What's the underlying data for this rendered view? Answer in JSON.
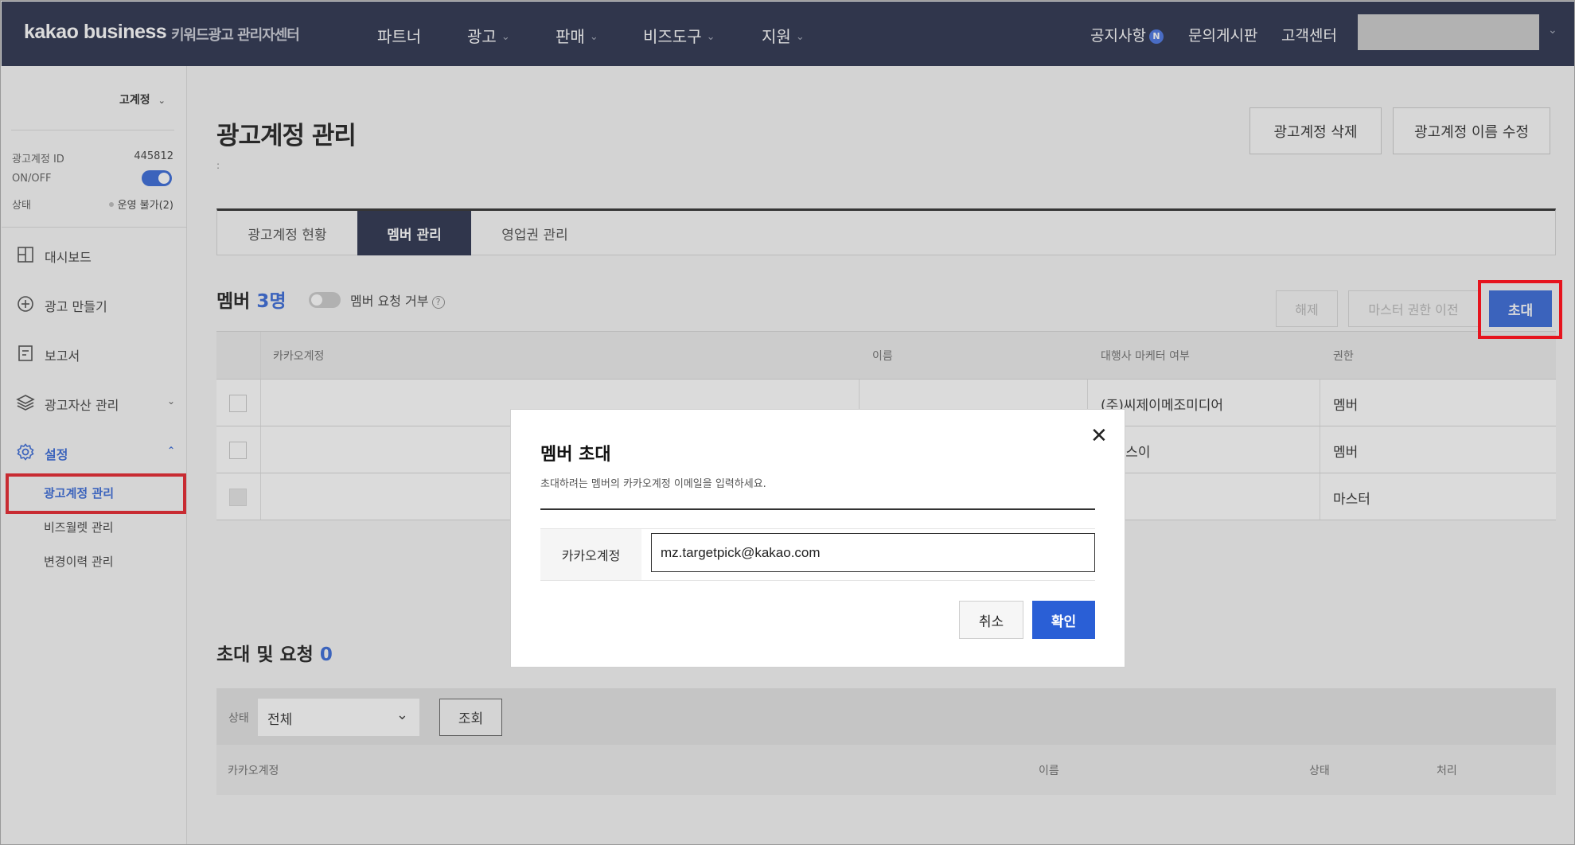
{
  "header": {
    "brand": "kakao business",
    "brand_sub": "키워드광고 관리자센터",
    "nav": [
      {
        "label": "파트너",
        "has_dropdown": false
      },
      {
        "label": "광고",
        "has_dropdown": true
      },
      {
        "label": "판매",
        "has_dropdown": true
      },
      {
        "label": "비즈도구",
        "has_dropdown": true
      },
      {
        "label": "지원",
        "has_dropdown": true
      }
    ],
    "notice": "공지사항",
    "notice_badge": "N",
    "inquiry": "문의게시판",
    "support": "고객센터"
  },
  "sidebar": {
    "account_select": "고계정",
    "account_id_label": "광고계정 ID",
    "account_id": "445812",
    "onoff_label": "ON/OFF",
    "onoff_state": true,
    "status_label": "상태",
    "status_value": "운영 불가(2)",
    "menu": [
      {
        "label": "대시보드",
        "icon": "dashboard-icon"
      },
      {
        "label": "광고 만들기",
        "icon": "plus-circle-icon"
      },
      {
        "label": "보고서",
        "icon": "report-icon"
      },
      {
        "label": "광고자산 관리",
        "icon": "layers-icon"
      },
      {
        "label": "설정",
        "icon": "gear-icon"
      }
    ],
    "submenu": [
      {
        "label": "광고계정 관리",
        "active": true
      },
      {
        "label": "비즈월렛 관리",
        "active": false
      },
      {
        "label": "변경이력 관리",
        "active": false
      }
    ]
  },
  "main": {
    "title": "광고계정 관리",
    "colon": ":",
    "delete_button": "광고계정 삭제",
    "rename_button": "광고계정 이름 수정",
    "tabs": [
      {
        "label": "광고계정 현황",
        "active": false
      },
      {
        "label": "멤버 관리",
        "active": true
      },
      {
        "label": "영업권 관리",
        "active": false
      }
    ],
    "member_title": "멤버",
    "member_count": "3명",
    "member_request_label": "멤버 요청 거부",
    "member_request_toggle": false,
    "btn_release": "해제",
    "btn_transfer": "마스터 권한 이전",
    "btn_invite": "초대",
    "table_headers": [
      "카카오계정",
      "이름",
      "대행사 마케터 여부",
      "권한"
    ],
    "rows": [
      {
        "account": "",
        "name": "",
        "agency": "(주)씨제이메조미디어",
        "role": "멤버",
        "checkbox_disabled": false
      },
      {
        "account": "",
        "name": "",
        "agency": "디엑스이",
        "role": "멤버",
        "checkbox_disabled": false
      },
      {
        "account": "",
        "name": "",
        "agency": "",
        "role": "마스터",
        "checkbox_disabled": true
      }
    ],
    "invites_title": "초대 및 요청",
    "invites_count": "0",
    "filter_label": "상태",
    "filter_value": "전체",
    "search_button": "조회",
    "invite_headers": [
      "카카오계정",
      "이름",
      "상태",
      "처리"
    ]
  },
  "modal": {
    "title": "멤버 초대",
    "description": "초대하려는 멤버의 카카오계정 이메일을 입력하세요.",
    "field_label": "카카오계정",
    "field_value": "mz.targetpick@kakao.com",
    "cancel": "취소",
    "confirm": "확인"
  },
  "colors": {
    "header_bg": "#1b2340",
    "accent": "#2a5fd6",
    "highlight": "#e6141e"
  }
}
